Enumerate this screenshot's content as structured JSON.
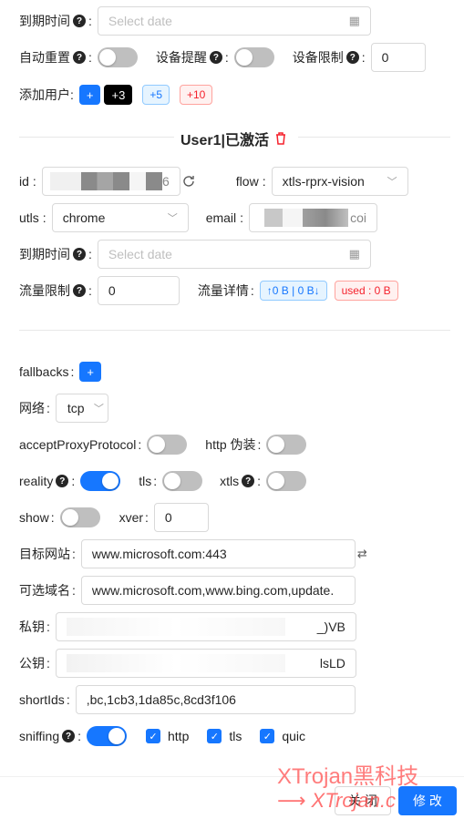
{
  "top": {
    "expiry_label": "到期时间",
    "expiry_placeholder": "Select date",
    "auto_reset_label": "自动重置",
    "device_reminder_label": "设备提醒",
    "device_limit_label": "设备限制",
    "device_limit_value": "0",
    "add_user_label": "添加用户",
    "add_plus": "+",
    "add_3": "+3",
    "add_5": "+5",
    "add_10": "+10"
  },
  "user": {
    "title": "User1|已激活",
    "id_label": "id",
    "id_value_tail": "6",
    "flow_label": "flow",
    "flow_value": "xtls-rprx-vision",
    "utls_label": "utls",
    "utls_value": "chrome",
    "email_label": "email",
    "email_value_tail": "coi",
    "expiry_label": "到期时间",
    "expiry_placeholder": "Select date",
    "traffic_limit_label": "流量限制",
    "traffic_limit_value": "0",
    "traffic_detail_label": "流量详情",
    "traffic_updown": "↑0 B | 0 B↓",
    "traffic_used": "used : 0 B"
  },
  "stream": {
    "fallbacks_label": "fallbacks",
    "fallbacks_add": "+",
    "network_label": "网络",
    "network_value": "tcp",
    "accept_proxy_label": "acceptProxyProtocol",
    "http_camouflage_label": "http 伪装",
    "reality_label": "reality",
    "tls_label": "tls",
    "xtls_label": "xtls",
    "show_label": "show",
    "xver_label": "xver",
    "xver_value": "0",
    "target_label": "目标网站",
    "target_value": "www.microsoft.com:443",
    "server_names_label": "可选域名",
    "server_names_value": "www.microsoft.com,www.bing.com,update.",
    "private_key_label": "私钥",
    "private_key_tail": "_)VB",
    "public_key_label": "公钥",
    "public_key_tail": "lsLD",
    "short_ids_label": "shortIds",
    "short_ids_value": ",bc,1cb3,1da85c,8cd3f106",
    "sniffing_label": "sniffing",
    "sniff_http": "http",
    "sniff_tls": "tls",
    "sniff_quic": "quic"
  },
  "footer": {
    "close": "关 闭",
    "modify": "修 改",
    "watermark": "XTrojan黑科技",
    "watermark2": "XTrojan.c"
  },
  "colors": {
    "primary": "#1677ff",
    "danger": "#f5222d"
  }
}
